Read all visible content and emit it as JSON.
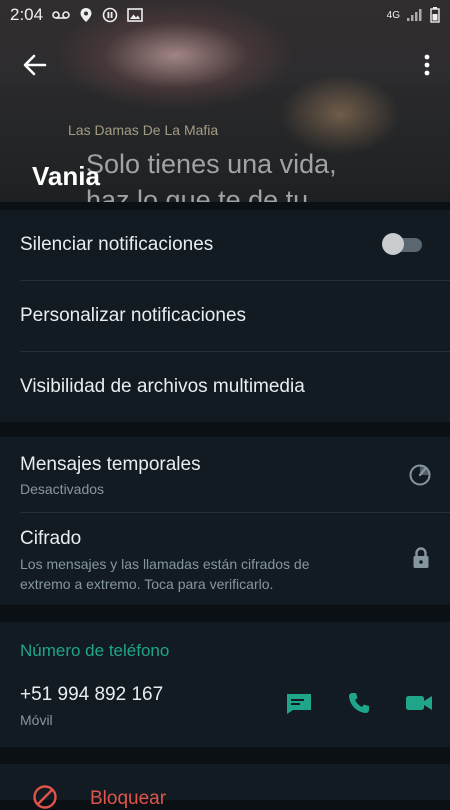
{
  "status_bar": {
    "time": "2:04",
    "network": "4G"
  },
  "header": {
    "contact_name": "Vania",
    "watermark_text": "Las Damas De La Mafia",
    "quote_line1": "Solo tienes una vida,",
    "quote_line2": "haz lo que te de tu"
  },
  "settings": {
    "mute_label": "Silenciar notificaciones",
    "mute_enabled": false,
    "custom_notifications_label": "Personalizar notificaciones",
    "media_visibility_label": "Visibilidad de archivos multimedia",
    "disappearing_label": "Mensajes temporales",
    "disappearing_value": "Desactivados",
    "encryption_label": "Cifrado",
    "encryption_desc_line1": "Los mensajes y las llamadas están cifrados de",
    "encryption_desc_line2": "extremo a extremo. Toca para verificarlo."
  },
  "phone": {
    "section_title": "Número de teléfono",
    "number": "+51 994 892 167",
    "type": "Móvil"
  },
  "block": {
    "label": "Bloquear"
  },
  "colors": {
    "accent": "#1fa58a",
    "danger": "#e0544b",
    "background": "#0b1014",
    "surface": "#121b22"
  }
}
